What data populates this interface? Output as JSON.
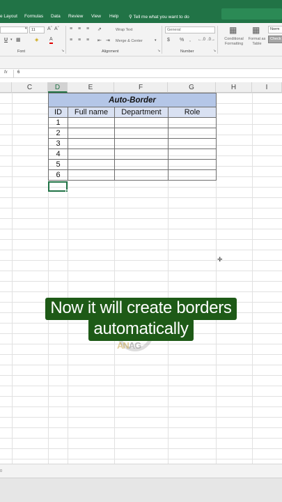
{
  "menu": {
    "tabs": [
      "e Layout",
      "Formulas",
      "Data",
      "Review",
      "View",
      "Help"
    ],
    "tell_me": "Tell me what you want to do"
  },
  "ribbon": {
    "font_size": "11",
    "wrap_text": "Wrap Text",
    "merge_center": "Merge & Center",
    "number_format": "General",
    "currency": "$",
    "percent": "%",
    "comma": ",",
    "conditional_formatting": "Conditional Formatting",
    "format_as_table": "Format as Table",
    "style_normal": "Norm",
    "style_check": "Check",
    "groups": {
      "font": "Font",
      "alignment": "Alignment",
      "number": "Number"
    }
  },
  "formula_bar": {
    "fx": "fx",
    "value": "6"
  },
  "columns": [
    "C",
    "D",
    "E",
    "F",
    "G",
    "H",
    "I"
  ],
  "active_column": "D",
  "table": {
    "title": "Auto-Border",
    "headers": [
      "ID",
      "Full name",
      "Department",
      "Role"
    ],
    "ids": [
      "1",
      "2",
      "3",
      "4",
      "5",
      "6"
    ]
  },
  "caption": {
    "line1": "Now it will create borders",
    "line2": "automatically"
  },
  "watermark": {
    "part1": "AN",
    "part2": "AG"
  },
  "sheet_bar": {
    "left_text": "0"
  },
  "colors": {
    "excel_green": "#217346",
    "title_fill": "#b4c6e7",
    "header_fill": "#d9e1f2",
    "caption_bg": "#1e5a17"
  }
}
